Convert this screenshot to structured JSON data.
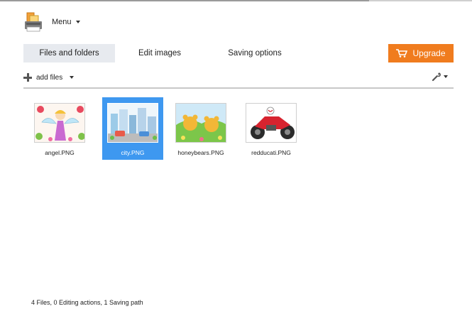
{
  "menu": {
    "label": "Menu"
  },
  "tabs": [
    {
      "label": "Files and folders",
      "active": true
    },
    {
      "label": "Edit images",
      "active": false
    },
    {
      "label": "Saving options",
      "active": false
    }
  ],
  "upgrade": {
    "label": "Upgrade",
    "color": "#f07c1e"
  },
  "toolbar": {
    "add_files_label": "add files"
  },
  "files": [
    {
      "name": "angel.PNG",
      "selected": false
    },
    {
      "name": "city.PNG",
      "selected": true
    },
    {
      "name": "honeybears.PNG",
      "selected": false
    },
    {
      "name": "redducati.PNG",
      "selected": false
    }
  ],
  "status": {
    "text": "4 Files, 0 Editing actions, 1 Saving path"
  },
  "colors": {
    "selection": "#3e98f0",
    "active_tab": "#e7eaef"
  }
}
